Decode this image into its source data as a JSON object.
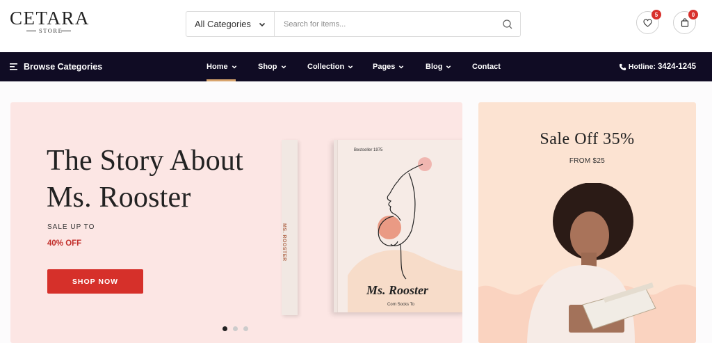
{
  "brand": {
    "name": "CETARA",
    "tagline": "STORE"
  },
  "search": {
    "category": "All Categories",
    "placeholder": "Search for items..."
  },
  "header": {
    "wishlist_count": "5",
    "cart_count": "0"
  },
  "nav": {
    "browse_label": "Browse Categories",
    "items": [
      {
        "label": "Home"
      },
      {
        "label": "Shop"
      },
      {
        "label": "Collection"
      },
      {
        "label": "Pages"
      },
      {
        "label": "Blog"
      },
      {
        "label": "Contact"
      }
    ],
    "hotline_label": "Hotline:",
    "hotline_number": "3424-1245"
  },
  "hero": {
    "title_line1": "The Story About",
    "title_line2": "Ms. Rooster",
    "sale_label": "SALE UP TO",
    "discount": "40% OFF",
    "button_label": "SHOP NOW",
    "book": {
      "spine_text": "MS. ROOSTER",
      "bestseller": "Bestseller 1975",
      "title": "Ms. Rooster",
      "subtitle": "Corn Socks To"
    },
    "slides": {
      "count": 3,
      "active": 0
    }
  },
  "promo": {
    "title": "Sale Off 35%",
    "from": "FROM $25"
  },
  "colors": {
    "accent_red": "#d6302a",
    "nav_bg": "#100c24",
    "hero_bg": "#fce6e4",
    "promo_bg": "#fce3d2",
    "nav_underline": "#d8a46d"
  }
}
